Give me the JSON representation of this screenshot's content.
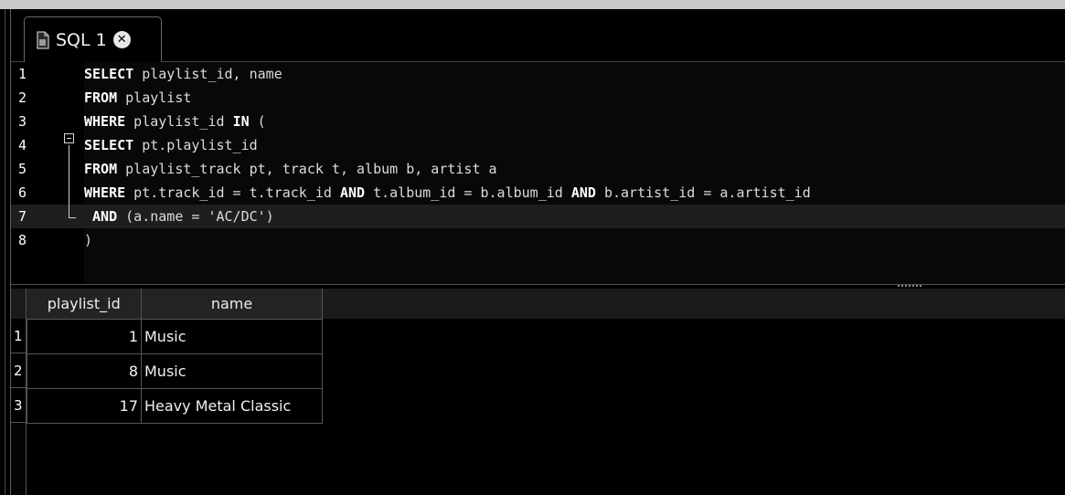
{
  "tab": {
    "label": "SQL 1",
    "doc_icon": "document-icon",
    "close_icon": "close-icon"
  },
  "editor": {
    "line_numbers": [
      "1",
      "2",
      "3",
      "4",
      "5",
      "6",
      "7",
      "8"
    ],
    "lines": [
      [
        {
          "t": "SELECT",
          "k": true
        },
        {
          "t": " playlist_id, name"
        }
      ],
      [
        {
          "t": "FROM",
          "k": true
        },
        {
          "t": " playlist"
        }
      ],
      [
        {
          "t": "WHERE",
          "k": true
        },
        {
          "t": " playlist_id "
        },
        {
          "t": "IN",
          "k": true
        },
        {
          "t": " ("
        }
      ],
      [
        {
          "t": "SELECT",
          "k": true
        },
        {
          "t": " pt.playlist_id"
        }
      ],
      [
        {
          "t": "FROM",
          "k": true
        },
        {
          "t": " playlist_track pt, track t, album b, artist a"
        }
      ],
      [
        {
          "t": "WHERE",
          "k": true
        },
        {
          "t": " pt.track_id = t.track_id "
        },
        {
          "t": "AND",
          "k": true
        },
        {
          "t": " t.album_id = b.album_id "
        },
        {
          "t": "AND",
          "k": true
        },
        {
          "t": " b.artist_id = a.artist_id"
        }
      ],
      [
        {
          "t": " AND",
          "k": true
        },
        {
          "t": " (a.name = 'AC/DC')"
        }
      ],
      [
        {
          "t": ")"
        }
      ]
    ],
    "current_line": 7
  },
  "results": {
    "columns": [
      "playlist_id",
      "name"
    ],
    "rows": [
      {
        "num": "1",
        "playlist_id": "1",
        "name": "Music"
      },
      {
        "num": "2",
        "playlist_id": "8",
        "name": "Music"
      },
      {
        "num": "3",
        "playlist_id": "17",
        "name": "Heavy Metal Classic"
      }
    ]
  }
}
